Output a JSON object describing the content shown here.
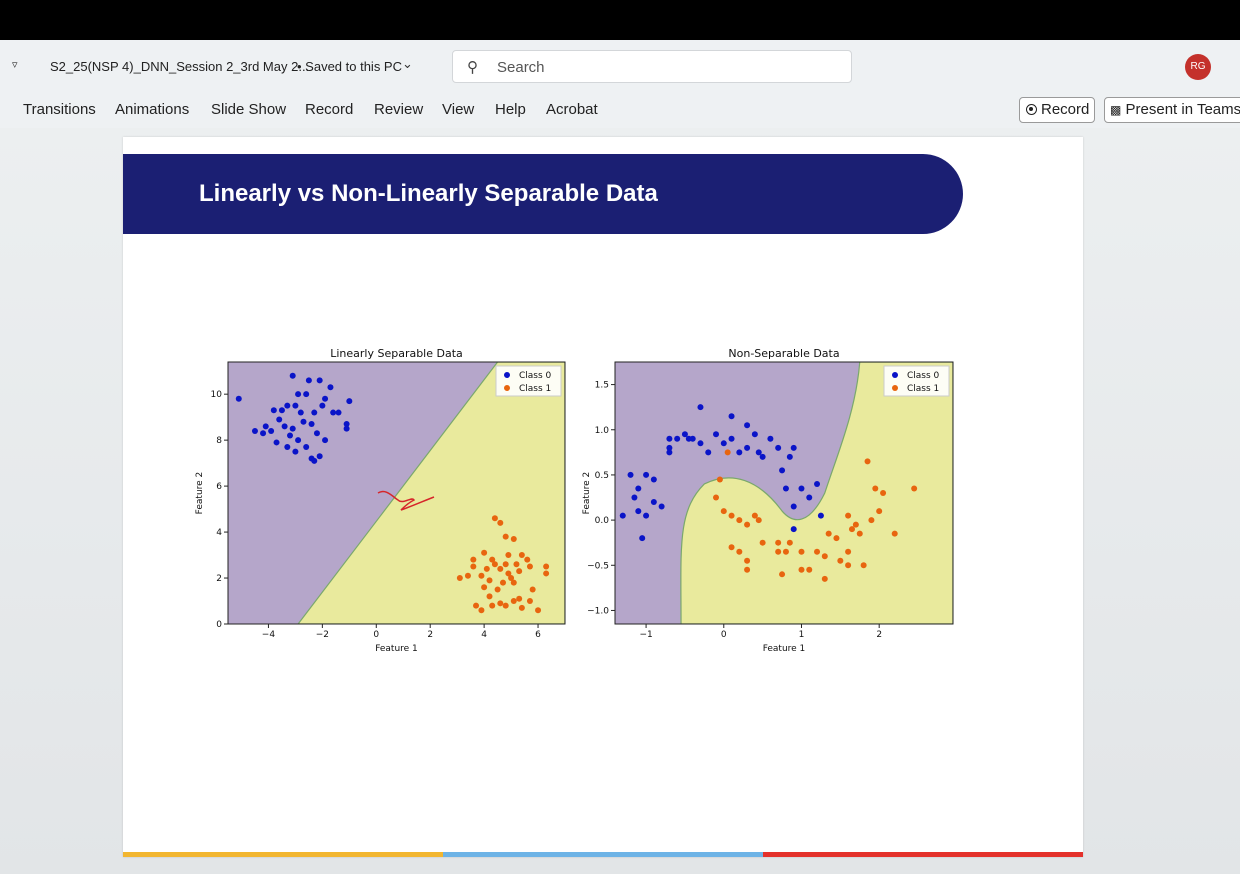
{
  "window": {
    "doc_title": "S2_25(NSP 4)_DNN_Session 2_3rd May 2...",
    "save_status": "• Saved to this PC",
    "search_placeholder": "Search",
    "avatar_initials": "RG"
  },
  "ribbon": {
    "tabs": [
      {
        "label": "Transitions"
      },
      {
        "label": "Animations"
      },
      {
        "label": "Slide Show"
      },
      {
        "label": "Record"
      },
      {
        "label": "Review"
      },
      {
        "label": "View"
      },
      {
        "label": "Help"
      },
      {
        "label": "Acrobat"
      }
    ],
    "record_button": "Record",
    "present_button": "Present in Teams"
  },
  "slide": {
    "title": "Linearly vs Non-Linearly Separable Data",
    "colors": {
      "banner": "#1b1f73",
      "footer": [
        "#f2b630",
        "#6db3e6",
        "#e4312b"
      ]
    }
  },
  "chart_data": [
    {
      "type": "scatter",
      "title": "Linearly Separable Data",
      "xlabel": "Feature 1",
      "ylabel": "Feature 2",
      "xlim": [
        -5.5,
        7
      ],
      "ylim": [
        0,
        11.4
      ],
      "xticks": [
        -4,
        -2,
        0,
        2,
        4,
        6
      ],
      "yticks": [
        0,
        2,
        4,
        6,
        8,
        10
      ],
      "boundary": {
        "type": "line",
        "points": [
          [
            -2.9,
            0
          ],
          [
            4.5,
            11.4
          ]
        ],
        "region_colors": [
          "#b5a6ca",
          "#e9ea9d"
        ]
      },
      "legend": {
        "placement": "upper right",
        "entries": [
          "Class 0",
          "Class 1"
        ]
      },
      "series": [
        {
          "name": "Class 0",
          "color": "#0a14c8",
          "points": [
            [
              -5.1,
              9.8
            ],
            [
              -3.1,
              10.8
            ],
            [
              -2.5,
              10.6
            ],
            [
              -2.1,
              10.6
            ],
            [
              -1.7,
              10.3
            ],
            [
              -1.9,
              9.8
            ],
            [
              -1,
              9.7
            ],
            [
              -2.6,
              10
            ],
            [
              -2.9,
              10
            ],
            [
              -3.5,
              9.3
            ],
            [
              -3.8,
              9.3
            ],
            [
              -3.3,
              9.5
            ],
            [
              -3,
              9.5
            ],
            [
              -2.8,
              9.2
            ],
            [
              -2.3,
              9.2
            ],
            [
              -2,
              9.5
            ],
            [
              -1.6,
              9.2
            ],
            [
              -1.4,
              9.2
            ],
            [
              -1.1,
              8.5
            ],
            [
              -1.1,
              8.7
            ],
            [
              -3.6,
              8.9
            ],
            [
              -3.4,
              8.6
            ],
            [
              -3.1,
              8.5
            ],
            [
              -2.7,
              8.8
            ],
            [
              -2.4,
              8.7
            ],
            [
              -2.2,
              8.3
            ],
            [
              -1.9,
              8
            ],
            [
              -4.2,
              8.3
            ],
            [
              -4.1,
              8.6
            ],
            [
              -3.9,
              8.4
            ],
            [
              -3.7,
              7.9
            ],
            [
              -3.3,
              7.7
            ],
            [
              -3,
              7.5
            ],
            [
              -2.6,
              7.7
            ],
            [
              -2.4,
              7.2
            ],
            [
              -2.3,
              7.1
            ],
            [
              -2.1,
              7.3
            ],
            [
              -4.5,
              8.4
            ],
            [
              -3.2,
              8.2
            ],
            [
              -2.9,
              8
            ]
          ]
        },
        {
          "name": "Class 1",
          "color": "#e8650f",
          "points": [
            [
              3.1,
              2
            ],
            [
              3.4,
              2.1
            ],
            [
              3.6,
              2.5
            ],
            [
              3.9,
              2.1
            ],
            [
              4,
              3.1
            ],
            [
              4.1,
              2.4
            ],
            [
              4.3,
              2.8
            ],
            [
              4.4,
              4.6
            ],
            [
              4.6,
              4.4
            ],
            [
              4.8,
              3.8
            ],
            [
              5.1,
              3.7
            ],
            [
              5.4,
              3
            ],
            [
              5.6,
              2.8
            ],
            [
              5.7,
              2.5
            ],
            [
              5.3,
              2.3
            ],
            [
              5,
              2
            ],
            [
              4.7,
              1.8
            ],
            [
              4.5,
              1.5
            ],
            [
              4.2,
              1.2
            ],
            [
              4,
              1.6
            ],
            [
              3.7,
              0.8
            ],
            [
              3.9,
              0.6
            ],
            [
              4.3,
              0.8
            ],
            [
              4.6,
              0.9
            ],
            [
              4.8,
              0.8
            ],
            [
              5.1,
              1
            ],
            [
              5.4,
              0.7
            ],
            [
              5.7,
              1
            ],
            [
              6,
              0.6
            ],
            [
              6.3,
              2.2
            ],
            [
              6.3,
              2.5
            ],
            [
              5.1,
              1.8
            ],
            [
              4.9,
              2.2
            ],
            [
              4.6,
              2.4
            ],
            [
              4.4,
              2.6
            ],
            [
              4.8,
              2.6
            ],
            [
              5.2,
              2.6
            ],
            [
              5.8,
              1.5
            ],
            [
              4.2,
              1.9
            ],
            [
              4.9,
              3
            ],
            [
              3.6,
              2.8
            ],
            [
              5.3,
              1.1
            ]
          ]
        }
      ]
    },
    {
      "type": "scatter",
      "title": "Non-Separable Data",
      "xlabel": "Feature 1",
      "ylabel": "Feature 2",
      "xlim": [
        -1.4,
        2.95
      ],
      "ylim": [
        -1.15,
        1.75
      ],
      "xticks": [
        -1,
        0,
        1,
        2
      ],
      "yticks": [
        -1.0,
        -0.5,
        0.0,
        0.5,
        1.0,
        1.5
      ],
      "boundary": {
        "type": "curve",
        "region_colors": [
          "#b5a6ca",
          "#e9ea9d"
        ]
      },
      "legend": {
        "placement": "upper right",
        "entries": [
          "Class 0",
          "Class 1"
        ]
      },
      "series": [
        {
          "name": "Class 0",
          "color": "#0a14c8",
          "points": [
            [
              -1.3,
              0.05
            ],
            [
              -1.2,
              0.5
            ],
            [
              -1.15,
              0.25
            ],
            [
              -1.1,
              0.35
            ],
            [
              -1.1,
              0.1
            ],
            [
              -1,
              0.5
            ],
            [
              -0.9,
              0.45
            ],
            [
              -1.05,
              -0.2
            ],
            [
              -1,
              0.05
            ],
            [
              -0.9,
              0.2
            ],
            [
              -0.8,
              0.15
            ],
            [
              -0.7,
              0.75
            ],
            [
              -0.7,
              0.9
            ],
            [
              -0.7,
              0.8
            ],
            [
              -0.6,
              0.9
            ],
            [
              -0.5,
              0.95
            ],
            [
              -0.45,
              0.9
            ],
            [
              -0.4,
              0.9
            ],
            [
              -0.3,
              1.25
            ],
            [
              -0.3,
              0.85
            ],
            [
              -0.2,
              0.75
            ],
            [
              -0.1,
              0.95
            ],
            [
              0,
              0.85
            ],
            [
              0.1,
              1.15
            ],
            [
              0.1,
              0.9
            ],
            [
              0.2,
              0.75
            ],
            [
              0.3,
              1.05
            ],
            [
              0.3,
              0.8
            ],
            [
              0.4,
              0.95
            ],
            [
              0.45,
              0.75
            ],
            [
              0.5,
              0.7
            ],
            [
              0.6,
              0.9
            ],
            [
              0.7,
              0.8
            ],
            [
              0.75,
              0.55
            ],
            [
              0.8,
              0.35
            ],
            [
              0.85,
              0.7
            ],
            [
              0.9,
              0.8
            ],
            [
              1,
              0.35
            ],
            [
              1.1,
              0.25
            ],
            [
              1.2,
              0.4
            ],
            [
              0.9,
              0.15
            ],
            [
              0.9,
              -0.1
            ],
            [
              1.25,
              0.05
            ]
          ]
        },
        {
          "name": "Class 1",
          "color": "#e8650f",
          "points": [
            [
              -0.05,
              0.45
            ],
            [
              0,
              0.1
            ],
            [
              0.1,
              0.05
            ],
            [
              0.2,
              0
            ],
            [
              0.3,
              -0.05
            ],
            [
              0.4,
              0.05
            ],
            [
              0.45,
              0
            ],
            [
              0.1,
              -0.3
            ],
            [
              0.2,
              -0.35
            ],
            [
              0.3,
              -0.45
            ],
            [
              0.3,
              -0.55
            ],
            [
              0.5,
              -0.25
            ],
            [
              0.7,
              -0.25
            ],
            [
              0.7,
              -0.35
            ],
            [
              0.75,
              -0.6
            ],
            [
              0.8,
              -0.35
            ],
            [
              0.85,
              -0.25
            ],
            [
              1,
              -0.35
            ],
            [
              1,
              -0.55
            ],
            [
              1.1,
              -0.55
            ],
            [
              1.2,
              -0.35
            ],
            [
              1.3,
              -0.4
            ],
            [
              1.3,
              -0.65
            ],
            [
              1.35,
              -0.15
            ],
            [
              1.45,
              -0.2
            ],
            [
              1.5,
              -0.45
            ],
            [
              1.6,
              0.05
            ],
            [
              1.6,
              -0.35
            ],
            [
              1.65,
              -0.1
            ],
            [
              1.7,
              -0.05
            ],
            [
              1.75,
              -0.15
            ],
            [
              1.8,
              -0.5
            ],
            [
              1.85,
              0.65
            ],
            [
              1.9,
              0
            ],
            [
              1.95,
              0.35
            ],
            [
              2,
              0.1
            ],
            [
              2.05,
              0.3
            ],
            [
              2.2,
              -0.15
            ],
            [
              2.45,
              0.35
            ],
            [
              -0.1,
              0.25
            ],
            [
              0.05,
              0.75
            ],
            [
              1.6,
              -0.5
            ]
          ]
        }
      ]
    }
  ]
}
